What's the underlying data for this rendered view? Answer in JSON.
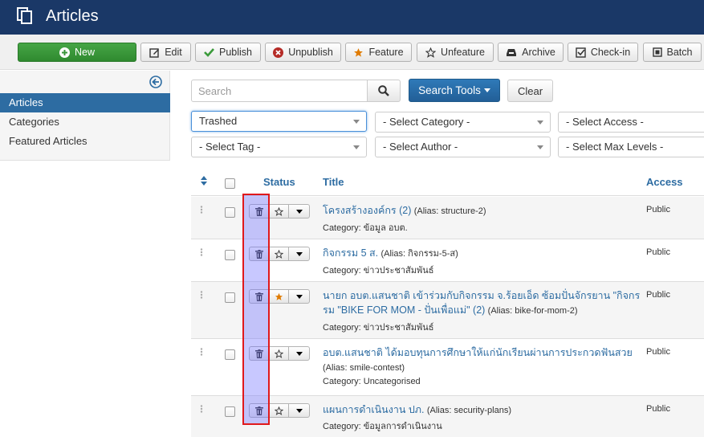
{
  "header": {
    "title": "Articles",
    "icon": "copy-icon"
  },
  "toolbar": {
    "new": "New",
    "edit": "Edit",
    "publish": "Publish",
    "unpublish": "Unpublish",
    "feature": "Feature",
    "unfeature": "Unfeature",
    "archive": "Archive",
    "checkin": "Check-in",
    "batch": "Batch"
  },
  "sidebar": {
    "items": [
      {
        "label": "Articles",
        "active": true
      },
      {
        "label": "Categories",
        "active": false
      },
      {
        "label": "Featured Articles",
        "active": false
      }
    ]
  },
  "search": {
    "placeholder": "Search",
    "search_tools": "Search Tools",
    "clear": "Clear"
  },
  "filters": {
    "status": "Trashed",
    "category": "- Select Category -",
    "access": "- Select Access -",
    "tag": "- Select Tag -",
    "author": "- Select Author -",
    "max_levels": "- Select Max Levels -"
  },
  "table": {
    "headers": {
      "status": "Status",
      "title": "Title",
      "access": "Access"
    },
    "rows": [
      {
        "title": "โครงสร้างองค์กร (2)",
        "alias": "(Alias: structure-2)",
        "category": "Category: ข้อมูล อบต.",
        "access": "Public",
        "featured": false
      },
      {
        "title": "กิจกรรม 5 ส.",
        "alias": "(Alias: กิจกรรม-5-ส)",
        "category": "Category: ข่าวประชาสัมพันธ์",
        "access": "Public",
        "featured": false
      },
      {
        "title_line1": "นายก อบต.แสนชาติ เข้าร่วมกับกิจกรรม จ.ร้อยเอ็ด ซ้อมปั่นจักรยาน \"กิจกร",
        "title_line2": "รม \"BIKE FOR MOM - ปั่นเพื่อแม่\" (2)",
        "alias": "(Alias: bike-for-mom-2)",
        "category": "Category: ข่าวประชาสัมพันธ์",
        "access": "Public",
        "featured": true
      },
      {
        "title": "อบต.แสนชาติ ได้มอบทุนการศึกษาให้แก่นักเรียนผ่านการประกวดฟันสวย",
        "alias": "(Alias: smile-contest)",
        "category": "Category: Uncategorised",
        "access": "Public",
        "featured": false
      },
      {
        "title": "แผนการดำเนินงาน ปภ.",
        "alias": "(Alias: security-plans)",
        "category": "Category: ข้อมูลการดำเนินงาน",
        "access": "Public",
        "featured": false
      }
    ]
  },
  "colors": {
    "header_bg": "#1a3867",
    "accent": "#2d6ca2",
    "highlight_border": "#e0191c",
    "feature_star": "#e07b00"
  }
}
